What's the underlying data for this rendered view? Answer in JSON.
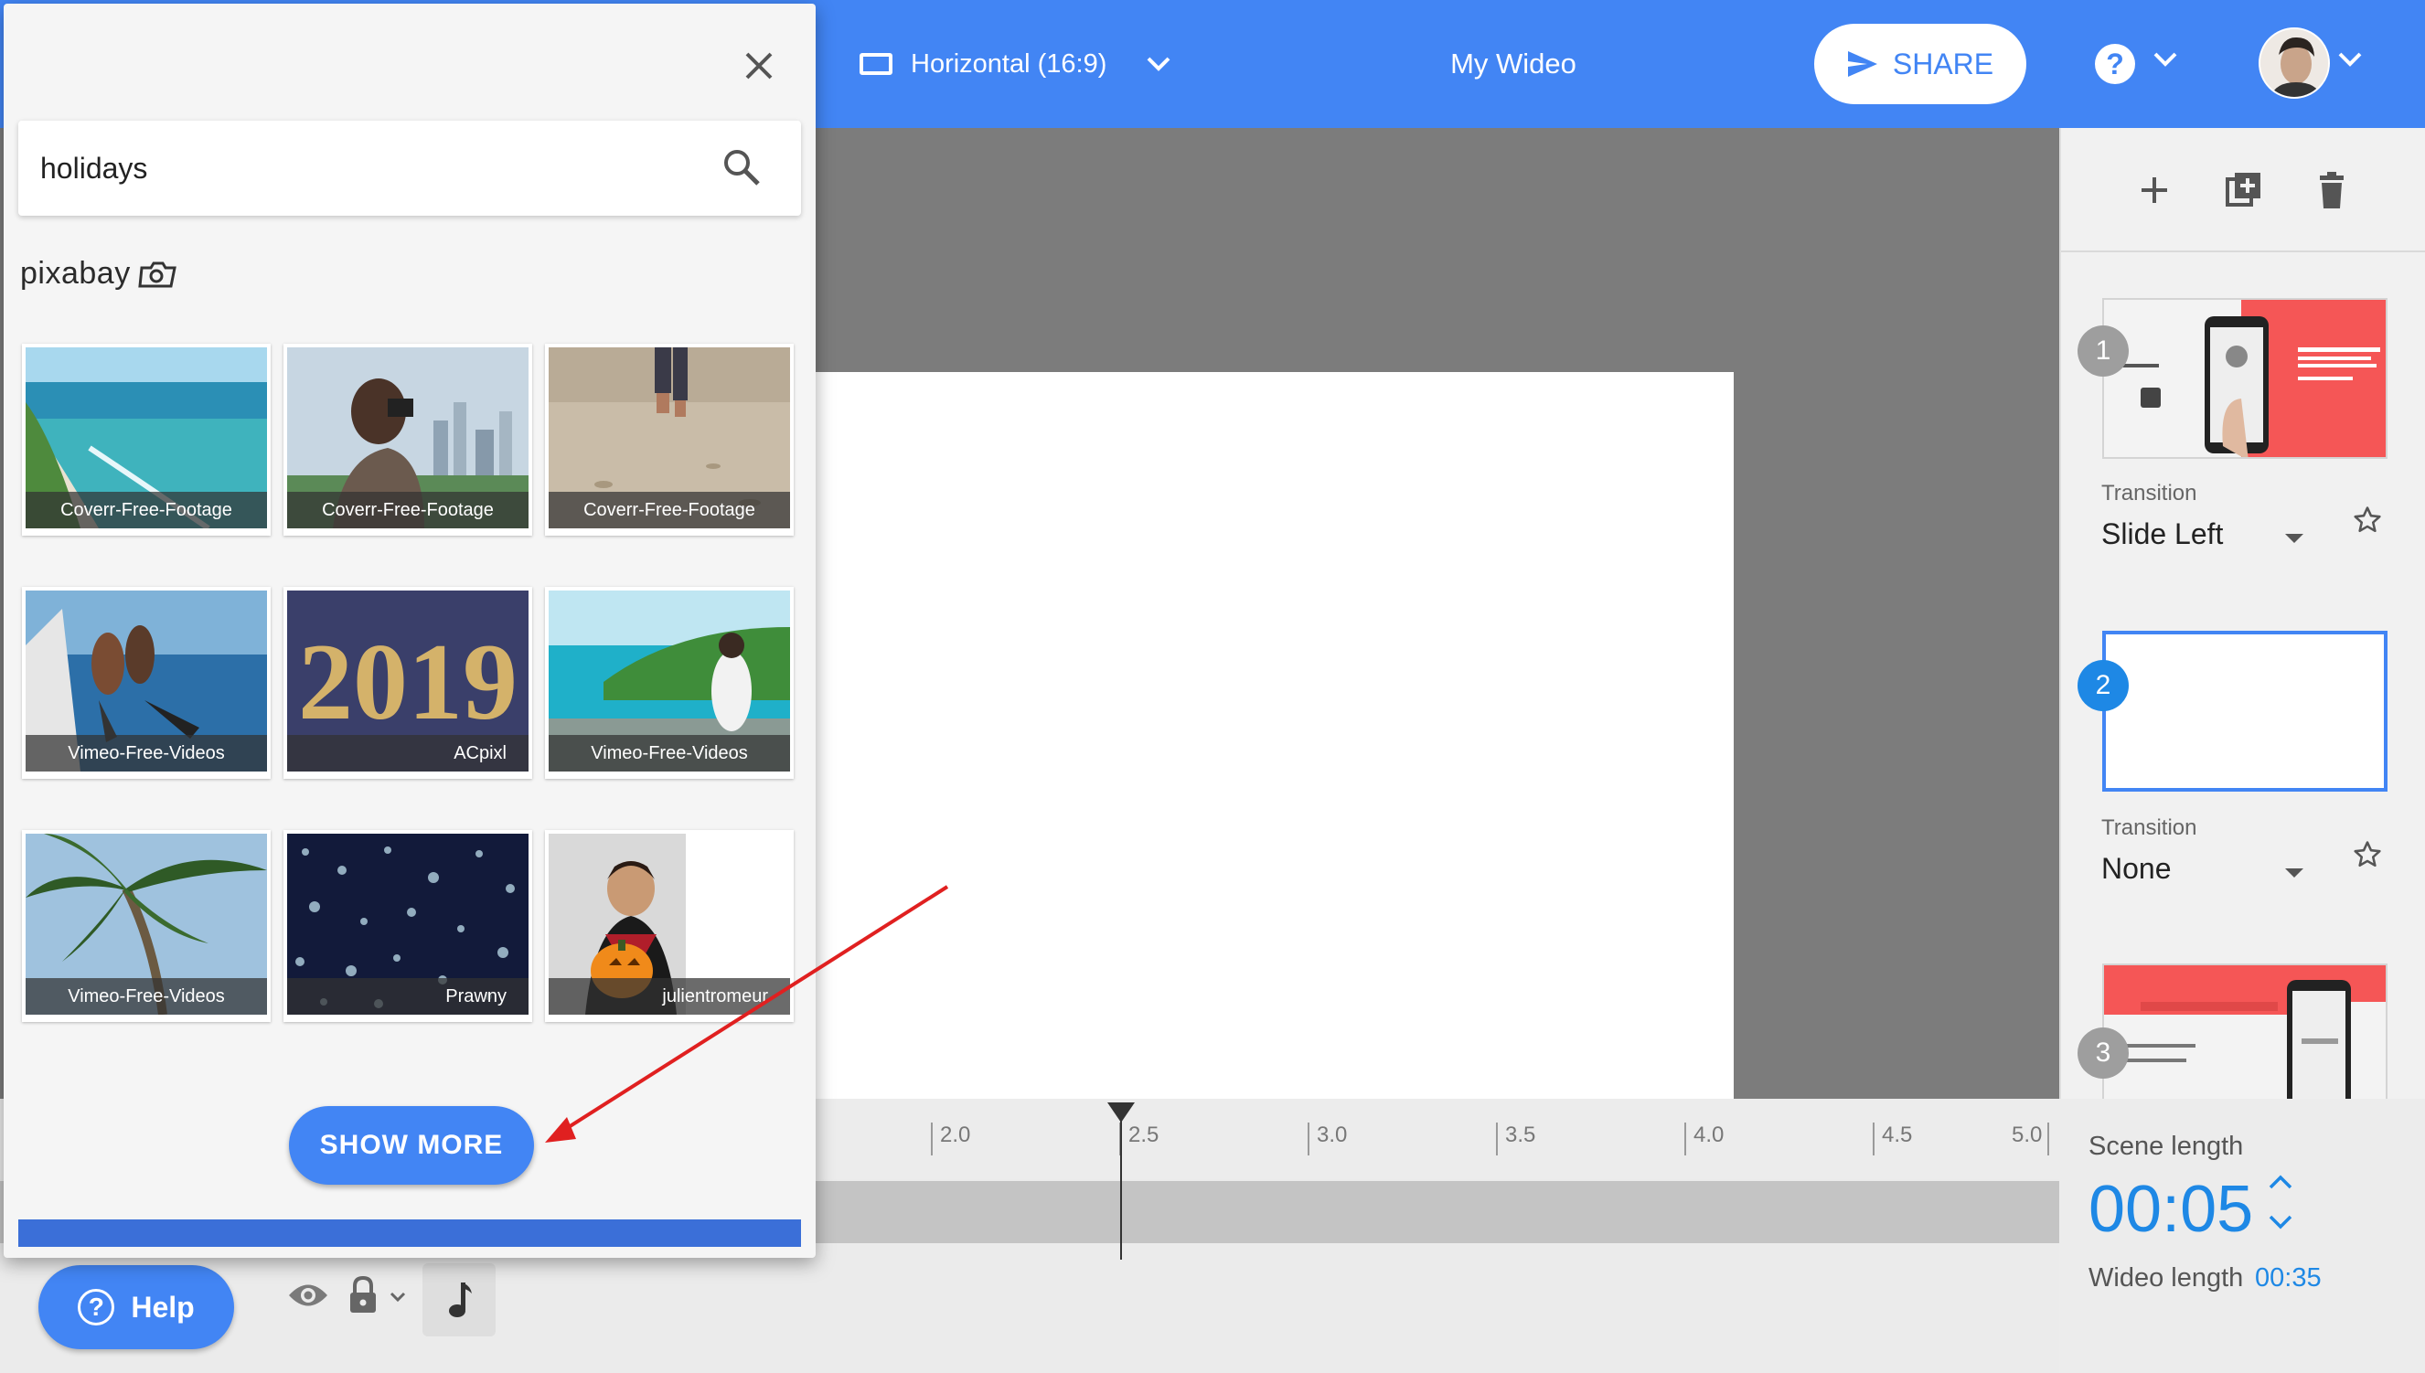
{
  "topbar": {
    "orientation": "Horizontal (16:9)",
    "wideo_title": "My Wideo",
    "share_label": "SHARE",
    "help_glyph": "?",
    "accent": "#4285f4"
  },
  "media_panel": {
    "search_value": "holidays",
    "provider": "pixabay",
    "results": [
      {
        "author": "Coverr-Free-Footage",
        "thumb": "beach-icon"
      },
      {
        "author": "Coverr-Free-Footage",
        "thumb": "photographer-icon"
      },
      {
        "author": "Coverr-Free-Footage",
        "thumb": "sand-walk-icon"
      },
      {
        "author": "Vimeo-Free-Videos",
        "thumb": "divers-icon"
      },
      {
        "author": "ACpixl",
        "thumb": "year-2019-icon"
      },
      {
        "author": "Vimeo-Free-Videos",
        "thumb": "coast-girl-icon"
      },
      {
        "author": "Vimeo-Free-Videos",
        "thumb": "palm-tree-icon"
      },
      {
        "author": "Prawny",
        "thumb": "snowflakes-icon"
      },
      {
        "author": "julientromeur",
        "thumb": "vampire-pumpkin-icon"
      }
    ],
    "year_text": "2019",
    "show_more_label": "SHOW MORE"
  },
  "scenes": [
    {
      "number": "1",
      "transition_label": "Transition",
      "transition": "Slide Left",
      "selected": false
    },
    {
      "number": "2",
      "transition_label": "Transition",
      "transition": "None",
      "selected": true
    },
    {
      "number": "3",
      "selected": false
    }
  ],
  "timeline": {
    "ticks": [
      "2.0",
      "2.5",
      "3.0",
      "3.5",
      "4.0",
      "4.5",
      "5.0"
    ],
    "playhead_time": 2.5
  },
  "scene_length": {
    "label": "Scene length",
    "value": "00:05",
    "wideo_length_label": "Wideo length",
    "wideo_length_value": "00:35"
  },
  "bottom": {
    "help_label": "Help",
    "help_glyph": "?"
  }
}
